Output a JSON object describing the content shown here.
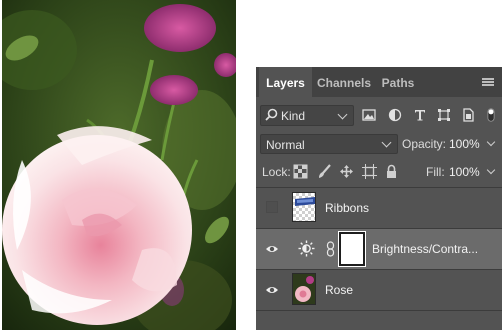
{
  "panel": {
    "tabs": [
      {
        "label": "Layers",
        "active": true
      },
      {
        "label": "Channels",
        "active": false
      },
      {
        "label": "Paths",
        "active": false
      }
    ],
    "filter": {
      "kind_label": "Kind"
    },
    "blend_mode": "Normal",
    "opacity_label": "Opacity:",
    "opacity_value": "100%",
    "lock_label": "Lock:",
    "fill_label": "Fill:",
    "fill_value": "100%",
    "layers": [
      {
        "name": "Ribbons",
        "visible": false,
        "selected": false
      },
      {
        "name": "Brightness/Contra...",
        "visible": true,
        "selected": true
      },
      {
        "name": "Rose",
        "visible": true,
        "selected": false
      }
    ]
  },
  "colors": {
    "panel_bg": "#535353",
    "tab_bar_bg": "#424242",
    "selected_row": "#6b6b6b"
  }
}
